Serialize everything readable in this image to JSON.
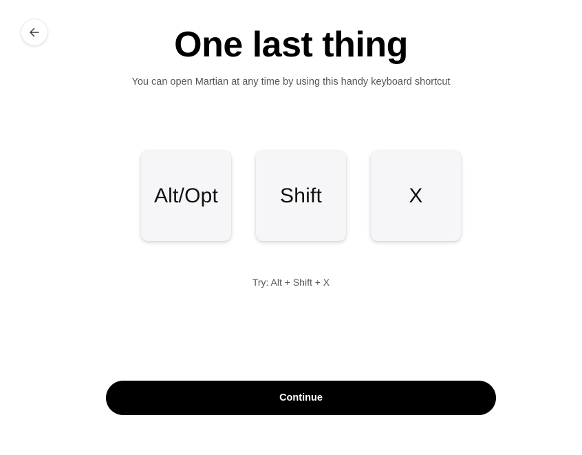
{
  "header": {
    "back_icon": "arrow-left-icon",
    "title": "One last thing",
    "subtitle": "You can open Martian at any time by using this handy keyboard shortcut"
  },
  "shortcut": {
    "keys": [
      {
        "label": "Alt/Opt"
      },
      {
        "label": "Shift"
      },
      {
        "label": "X"
      }
    ],
    "hint": "Try: Alt + Shift + X"
  },
  "footer": {
    "continue_label": "Continue"
  },
  "colors": {
    "background": "#ffffff",
    "title": "#000000",
    "muted_text": "#55565c",
    "key_background": "#f6f6f8",
    "button_background": "#000000",
    "button_text": "#ffffff"
  }
}
